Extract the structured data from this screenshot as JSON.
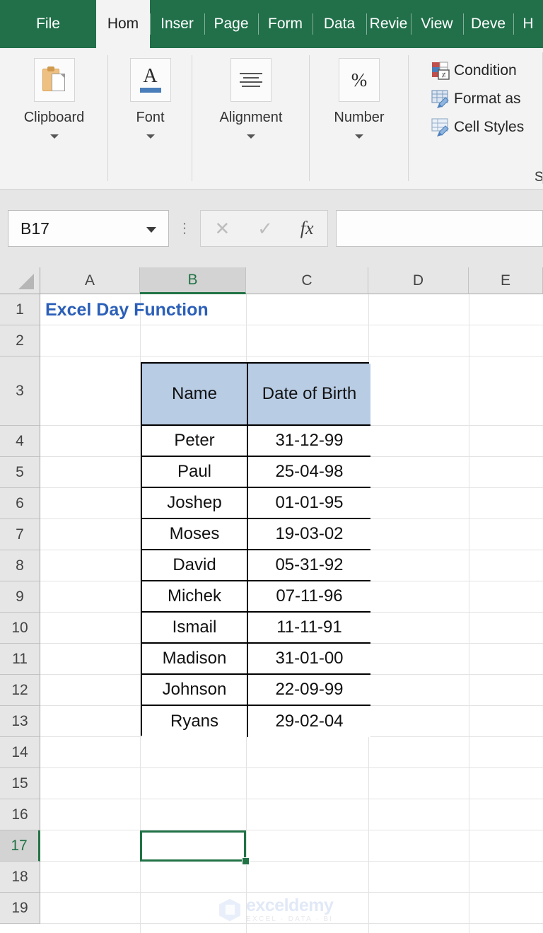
{
  "ribbon": {
    "tabs": [
      {
        "label": "File",
        "active": false
      },
      {
        "label": "Hom",
        "active": true
      },
      {
        "label": "Inser",
        "active": false
      },
      {
        "label": "Page",
        "active": false
      },
      {
        "label": "Form",
        "active": false
      },
      {
        "label": "Data",
        "active": false
      },
      {
        "label": "Revie",
        "active": false
      },
      {
        "label": "View",
        "active": false
      },
      {
        "label": "Deve",
        "active": false
      },
      {
        "label": "H",
        "active": false
      }
    ],
    "groups": [
      {
        "label": "Clipboard",
        "icon": "clipboard-paste-icon"
      },
      {
        "label": "Font",
        "icon": "font-a-icon"
      },
      {
        "label": "Alignment",
        "icon": "alignment-icon"
      },
      {
        "label": "Number",
        "icon": "percent-icon"
      }
    ],
    "styles": {
      "caption": "St",
      "items": [
        {
          "label": "Condition",
          "icon": "conditional-formatting-icon"
        },
        {
          "label": "Format as",
          "icon": "format-as-table-icon"
        },
        {
          "label": "Cell Styles",
          "icon": "cell-styles-icon"
        }
      ]
    }
  },
  "formula_bar": {
    "name_box_value": "B17",
    "cancel_glyph": "✕",
    "enter_glyph": "✓",
    "fx_label": "fx",
    "formula_value": "",
    "formula_placeholder": ""
  },
  "grid": {
    "columns": [
      "A",
      "B",
      "C",
      "D",
      "E"
    ],
    "selected_column": "B",
    "rows": [
      "1",
      "2",
      "3",
      "4",
      "5",
      "6",
      "7",
      "8",
      "9",
      "10",
      "11",
      "12",
      "13",
      "14",
      "15",
      "16",
      "17",
      "18",
      "19"
    ],
    "selected_row": "17",
    "selected_cell": "B17",
    "title_cell": {
      "ref": "B1",
      "text": "Excel Day Function"
    }
  },
  "table": {
    "headers": [
      "Name",
      "Date of Birth"
    ],
    "rows": [
      {
        "name": "Peter",
        "dob": "31-12-99"
      },
      {
        "name": "Paul",
        "dob": "25-04-98"
      },
      {
        "name": "Joshep",
        "dob": "01-01-95"
      },
      {
        "name": "Moses",
        "dob": "19-03-02"
      },
      {
        "name": "David",
        "dob": "05-31-92"
      },
      {
        "name": "Michek",
        "dob": "07-11-96"
      },
      {
        "name": "Ismail",
        "dob": "11-11-91"
      },
      {
        "name": "Madison",
        "dob": "31-01-00"
      },
      {
        "name": "Johnson",
        "dob": "22-09-99"
      },
      {
        "name": "Ryans",
        "dob": "29-02-04"
      }
    ]
  },
  "watermark": {
    "main": "exceldemy",
    "sub": "EXCEL · DATA · BI"
  },
  "colors": {
    "ribbon_green": "#21704a",
    "excel_green": "#217346",
    "title_blue": "#2b5fb8",
    "header_fill": "#b8cce4",
    "header_gray": "#e6e6e6"
  }
}
